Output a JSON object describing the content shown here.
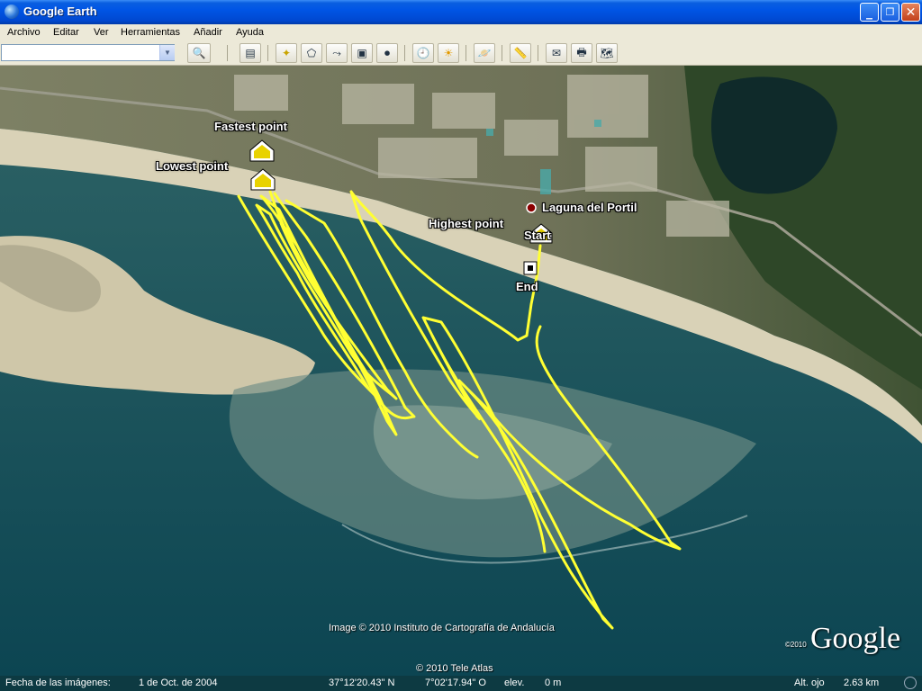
{
  "window": {
    "title": "Google Earth"
  },
  "menu": [
    "Archivo",
    "Editar",
    "Ver",
    "Herramientas",
    "Añadir",
    "Ayuda"
  ],
  "search": {
    "value": ""
  },
  "map": {
    "labels": {
      "fastest": "Fastest point",
      "lowest": "Lowest point",
      "highest": "Highest point",
      "start": "Start",
      "end": "End",
      "place": "Laguna del Portil"
    },
    "image_credit": "Image © 2010 Instituto de Cartografía de Andalucía",
    "tele_atlas": "© 2010 Tele Atlas",
    "logo": {
      "text": "Google",
      "year": "©2010"
    },
    "track_color": "#ffff33"
  },
  "status": {
    "date_label": "Fecha de las imágenes:",
    "date_value": "1 de Oct. de 2004",
    "lat": "37°12'20.43\" N",
    "lon": "7°02'17.94\" O",
    "elev_label": "elev.",
    "elev_value": "0 m",
    "eye_label": "Alt. ojo",
    "eye_value": "2.63 km"
  }
}
